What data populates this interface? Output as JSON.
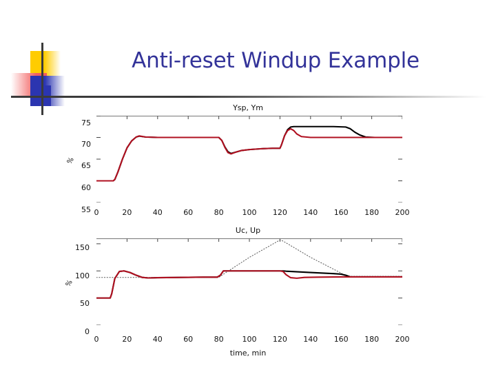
{
  "slide": {
    "title": "Anti-reset Windup Example",
    "title_color": "#333399",
    "logo": {
      "yellow": "#FFCC00",
      "red": "#F05B5B",
      "blue": "#2B35B0",
      "bar": "#3B3B3B"
    }
  },
  "colors": {
    "measured": "#B01020",
    "setpoint": "#000000",
    "unlimited": "#555555",
    "axis": "#111111"
  },
  "chart_data": [
    {
      "type": "line",
      "title": "Ysp, Ym",
      "xlabel": "",
      "ylabel": "%",
      "xlim": [
        0,
        200
      ],
      "ylim": [
        55,
        75
      ],
      "grid": false,
      "legend": "none",
      "xticks": [
        0,
        20,
        40,
        60,
        80,
        100,
        120,
        140,
        160,
        180,
        200
      ],
      "yticks": [
        75,
        70,
        65,
        60,
        55
      ],
      "series": [
        {
          "name": "Ysp",
          "color": "#000000",
          "style": "solid",
          "x": [
            0,
            11,
            12,
            14,
            17,
            20,
            23,
            26,
            28,
            32,
            40,
            50,
            60,
            70,
            79,
            80,
            82,
            84,
            86,
            88,
            91,
            95,
            100,
            108,
            115,
            120,
            121,
            123,
            125,
            127,
            129,
            135,
            145,
            155,
            163,
            166,
            169,
            172,
            176,
            182,
            190,
            200
          ],
          "y": [
            60.0,
            60.0,
            60.3,
            62.0,
            65.0,
            67.6,
            69.2,
            70.1,
            70.3,
            70.1,
            70.0,
            70.0,
            70.0,
            70.0,
            70.0,
            70.0,
            69.3,
            67.8,
            66.7,
            66.3,
            66.6,
            67.0,
            67.2,
            67.4,
            67.5,
            67.5,
            68.3,
            70.4,
            71.8,
            72.4,
            72.5,
            72.5,
            72.5,
            72.5,
            72.4,
            72.0,
            71.2,
            70.6,
            70.1,
            70.0,
            70.0,
            70.0
          ]
        },
        {
          "name": "Ym",
          "color": "#B01020",
          "style": "solid",
          "x": [
            0,
            11,
            12,
            14,
            17,
            20,
            23,
            26,
            28,
            32,
            40,
            50,
            60,
            70,
            79,
            80,
            82,
            84,
            86,
            88,
            91,
            95,
            100,
            108,
            115,
            120,
            121,
            123,
            125,
            127,
            129,
            131,
            134,
            140,
            150,
            160,
            170,
            180,
            190,
            200
          ],
          "y": [
            60.0,
            60.0,
            60.3,
            62.0,
            65.0,
            67.6,
            69.2,
            70.1,
            70.35,
            70.1,
            70.0,
            70.0,
            70.0,
            70.0,
            70.0,
            70.0,
            69.3,
            67.7,
            66.5,
            66.2,
            66.6,
            67.0,
            67.2,
            67.4,
            67.5,
            67.5,
            68.3,
            70.4,
            71.6,
            72.0,
            71.6,
            70.8,
            70.2,
            70.0,
            70.0,
            70.0,
            70.0,
            70.0,
            70.0,
            70.0
          ]
        }
      ]
    },
    {
      "type": "line",
      "title": "Uc, Up",
      "xlabel": "time, min",
      "ylabel": "%",
      "xlim": [
        0,
        200
      ],
      "ylim": [
        0,
        160
      ],
      "grid": false,
      "legend": "none",
      "xticks": [
        0,
        20,
        40,
        60,
        80,
        100,
        120,
        140,
        160,
        180,
        200
      ],
      "yticks": [
        150,
        100,
        50,
        0
      ],
      "series": [
        {
          "name": "Uc unlimited",
          "color": "#555555",
          "style": "dotted",
          "x": [
            0,
            80,
            82,
            100,
            120,
            122,
            140,
            160,
            163,
            200
          ],
          "y": [
            88,
            88,
            92,
            125,
            157,
            155,
            125,
            96,
            90,
            90
          ]
        },
        {
          "name": "Uc",
          "color": "#000000",
          "style": "solid",
          "x": [
            0,
            9,
            10,
            12,
            15,
            18,
            22,
            26,
            30,
            34,
            40,
            55,
            70,
            79,
            81,
            83,
            90,
            100,
            110,
            120,
            122,
            124,
            140,
            155,
            160,
            163,
            166,
            175,
            190,
            200
          ],
          "y": [
            50,
            50,
            58,
            86,
            99,
            100,
            97,
            92,
            88,
            87,
            87.5,
            88,
            88.5,
            88.5,
            92,
            100,
            100,
            100,
            100,
            100,
            100,
            99.5,
            97,
            95,
            94,
            92,
            89,
            89,
            89,
            89
          ]
        },
        {
          "name": "Up",
          "color": "#B01020",
          "style": "solid",
          "x": [
            0,
            9,
            10,
            12,
            15,
            18,
            22,
            26,
            30,
            34,
            40,
            55,
            70,
            79,
            81,
            83,
            90,
            100,
            110,
            120,
            122,
            124,
            127,
            131,
            136,
            145,
            155,
            162,
            166,
            175,
            190,
            200
          ],
          "y": [
            50,
            50,
            58,
            86,
            99,
            100,
            97,
            92,
            88,
            87,
            87.5,
            88,
            88.5,
            88.5,
            92,
            100,
            100,
            100,
            100,
            100,
            99,
            93,
            87.5,
            86.5,
            88,
            88.5,
            88.8,
            89,
            89,
            89,
            89,
            89
          ]
        }
      ]
    }
  ]
}
